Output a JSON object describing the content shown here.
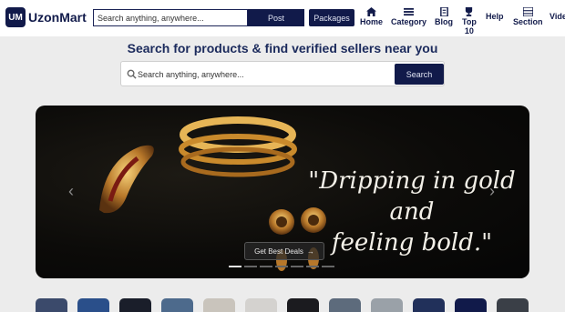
{
  "header": {
    "logo_badge": "UM",
    "logo_text": "UzonMart",
    "search_value": "Search anything, anywhere...",
    "post_label": "Post",
    "packages_label": "Packages",
    "nav": [
      {
        "label": "Home",
        "icon": "home-icon"
      },
      {
        "label": "Category",
        "icon": "category-icon"
      },
      {
        "label": "Blog",
        "icon": "blog-icon"
      },
      {
        "label": "Top 10",
        "line1": "Top",
        "line2": "10",
        "icon": "trophy-icon"
      },
      {
        "label": "Help",
        "icon": "help-icon"
      },
      {
        "label": "Section",
        "icon": "section-icon"
      },
      {
        "label": "Vide",
        "icon": "video-icon"
      }
    ]
  },
  "tagline": "Search for products & find verified sellers near you",
  "main_search": {
    "value": "Search anything, anywhere...",
    "button_label": "Search"
  },
  "banner": {
    "quote_line1": "\"Dripping in gold and",
    "quote_line2": "feeling bold.\"",
    "cta_label": "Get Best Deals",
    "cta_icon": "arrow-right-icon",
    "slide_count": 7,
    "active_slide": 1
  },
  "colors": {
    "brand_navy": "#111a4a",
    "tagline": "#1b2a5c",
    "page_bg": "#ececec"
  },
  "thumbnails": [
    {
      "name": "category-thumb-1",
      "color": "#3b4a6b"
    },
    {
      "name": "category-thumb-2",
      "color": "#2a4f8a"
    },
    {
      "name": "category-thumb-3",
      "color": "#1a1e2a"
    },
    {
      "name": "category-thumb-4",
      "color": "#4d6a8c"
    },
    {
      "name": "category-thumb-5",
      "color": "#c9c4bc"
    },
    {
      "name": "category-thumb-6",
      "color": "#d4d2cf"
    },
    {
      "name": "category-thumb-7",
      "color": "#1b1b1f"
    },
    {
      "name": "category-thumb-8",
      "color": "#5d6b7c"
    },
    {
      "name": "category-thumb-9",
      "color": "#9aa1a8"
    },
    {
      "name": "category-thumb-10",
      "color": "#21305a"
    },
    {
      "name": "category-thumb-11",
      "color": "#111a4a"
    },
    {
      "name": "category-thumb-12",
      "color": "#3a3f47"
    }
  ]
}
